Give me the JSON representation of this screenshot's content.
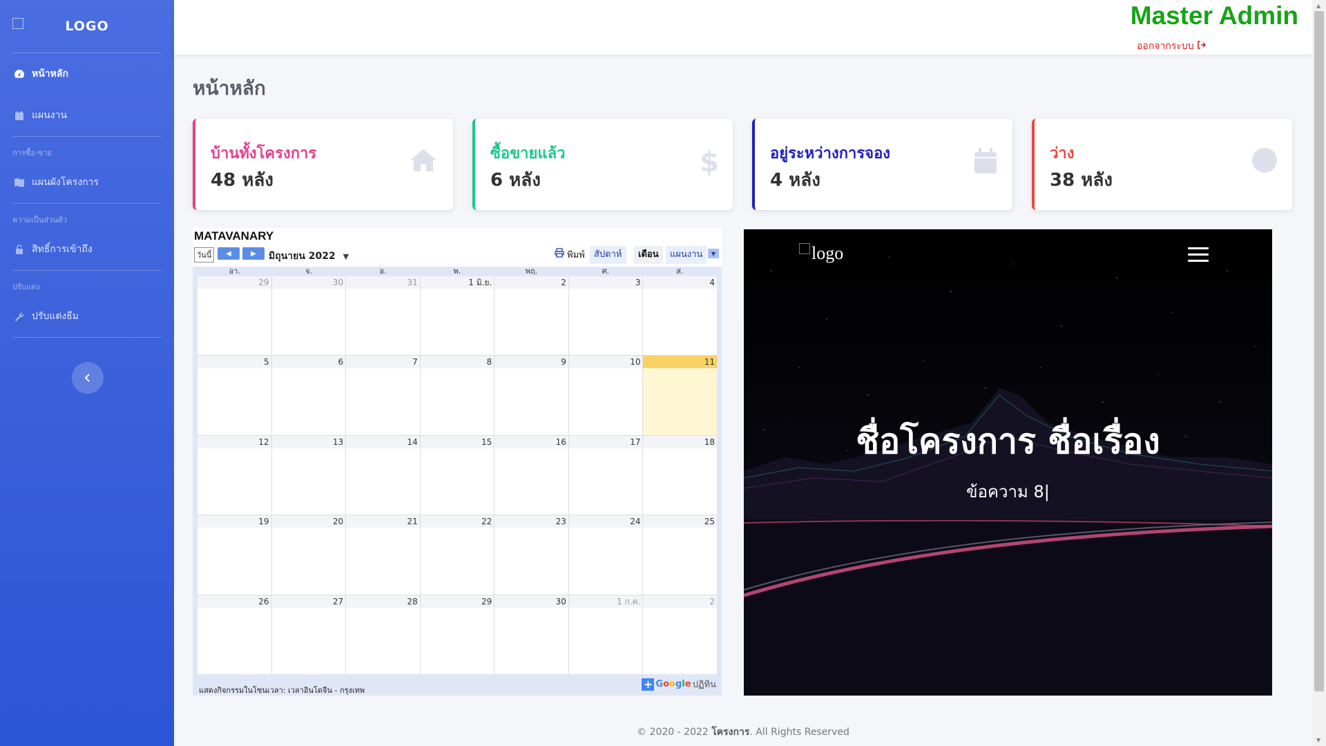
{
  "sidebar": {
    "brand": "LOGO",
    "items": [
      {
        "label": "หน้าหลัก"
      },
      {
        "label": "แผนงาน"
      }
    ],
    "sections": [
      {
        "heading": "การซื้อ-ขาย",
        "item": "แผนผังโครงการ"
      },
      {
        "heading": "ความเป็นส่วนตัว",
        "item": "สิทธิ์การเข้าถึง"
      },
      {
        "heading": "ปรับแต่ง",
        "item": "ปรับแต่งธีม"
      }
    ]
  },
  "topbar": {
    "admin_name": "Master Admin",
    "logout": "ออกจากระบบ"
  },
  "page_title": "หน้าหลัก",
  "cards": [
    {
      "title": "บ้านทั้งโครงการ",
      "value": "48 หลัง",
      "color": "#e83e8c",
      "icon": "home-icon"
    },
    {
      "title": "ซื้อขายแล้ว",
      "value": "6 หลัง",
      "color": "#1cc88a",
      "icon": "dollar-icon"
    },
    {
      "title": "อยู่ระหว่างการจอง",
      "value": "4 หลัง",
      "color": "#2020c0",
      "icon": "calendar-icon"
    },
    {
      "title": "ว่าง",
      "value": "38 หลัง",
      "color": "#e74a3b",
      "icon": "circle-icon"
    }
  ],
  "calendar": {
    "title": "MATAVANARY",
    "today_button": "วันนี้",
    "month_label": "มิถุนายน 2022",
    "print": "พิมพ์",
    "views": [
      "สัปดาห์",
      "เดือน",
      "แผนงาน"
    ],
    "selected_view": "เดือน",
    "days_of_week": [
      "อา.",
      "จ.",
      "อ.",
      "พ.",
      "พฤ.",
      "ศ.",
      "ส."
    ],
    "weeks": [
      [
        "29",
        "30",
        "31",
        "1 มิ.ย.",
        "2",
        "3",
        "4"
      ],
      [
        "5",
        "6",
        "7",
        "8",
        "9",
        "10",
        "11"
      ],
      [
        "12",
        "13",
        "14",
        "15",
        "16",
        "17",
        "18"
      ],
      [
        "19",
        "20",
        "21",
        "22",
        "23",
        "24",
        "25"
      ],
      [
        "26",
        "27",
        "28",
        "29",
        "30",
        "1 ก.ค.",
        "2"
      ]
    ],
    "timezone_text": "แสดงกิจกรรมในโซนเวลา: เวลาอินโดจีน - กรุงเทพ",
    "gcal_label": "Google",
    "gcal_suffix": "ปฏิทิน"
  },
  "banner": {
    "logo_alt": "logo",
    "title": "ชื่อโครงการ ชื่อเรื่อง",
    "subtitle": "ข้อความ 8|"
  },
  "footer": {
    "prefix": "© 2020 - 2022 ",
    "brand": "โครงการ",
    "suffix": ". All Rights Reserved"
  }
}
